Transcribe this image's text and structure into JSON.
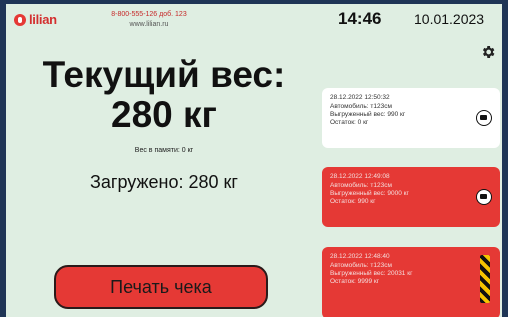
{
  "header": {
    "logo_text": "lilian",
    "phone": "8-800-555-126 доб. 123",
    "website": "www.lilian.ru",
    "time": "14:46",
    "date": "10.01.2023"
  },
  "main": {
    "weight_title": "Текущий вес:",
    "weight_value": "280 кг",
    "memory_weight": "Вес в памяти: 0 кг",
    "loaded": "Загружено: 280 кг",
    "print_button": "Печать чека"
  },
  "receipts": [
    {
      "datetime": "28.12.2022 12:50:32",
      "vehicle": "Автомобиль: т123см",
      "unloaded": "Выгруженный вес: 990 кг",
      "remaining": "Остаток: 0 кг",
      "status": "white"
    },
    {
      "datetime": "28.12.2022 12:49:08",
      "vehicle": "Автомобиль: т123см",
      "unloaded": "Выгруженный вес: 9000 кг",
      "remaining": "Остаток: 990 кг",
      "status": "red"
    },
    {
      "datetime": "28.12.2022 12:48:40",
      "vehicle": "Автомобиль: т123см",
      "unloaded": "Выгруженный вес: 20031 кг",
      "remaining": "Остаток: 9999 кг",
      "status": "red"
    }
  ],
  "icons": {
    "settings": "gear-icon",
    "print": "printer-icon",
    "scroll_marker": "hazard-stripe-icon"
  },
  "colors": {
    "background": "#dfeee2",
    "accent_red": "#e53935",
    "frame": "#1f3556"
  }
}
